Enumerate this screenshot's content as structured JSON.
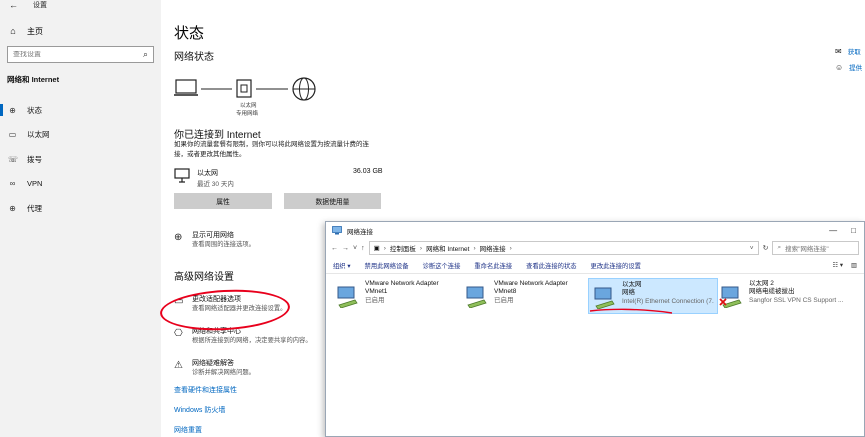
{
  "settings": {
    "back_glyph": "←",
    "window_title": "设置",
    "home_label": "主页",
    "search_placeholder": "查找设置",
    "section_label": "网络和 Internet",
    "nav": [
      {
        "label": "状态",
        "icon": "globe-icon",
        "active": true
      },
      {
        "label": "以太网",
        "icon": "monitor-icon",
        "active": false
      },
      {
        "label": "拨号",
        "icon": "phone-icon",
        "active": false
      },
      {
        "label": "VPN",
        "icon": "vpn-icon",
        "active": false
      },
      {
        "label": "代理",
        "icon": "globe-icon",
        "active": false
      }
    ]
  },
  "status": {
    "title": "状态",
    "subtitle": "网络状态",
    "diagram_label_1": "以太网",
    "diagram_label_2": "专用网络",
    "connected_title": "你已连接到 Internet",
    "connected_desc": "如果你的流量套餐有限制，则你可以将此网络设置为按流量计费的连接，或者更改其他属性。",
    "network_name": "以太网",
    "network_sub": "最近 30 天内",
    "network_usage": "36.03 GB",
    "btn_properties": "属性",
    "btn_data_usage": "数据使用量",
    "show_networks_title": "显示可用网络",
    "show_networks_sub": "查看周围的连接选项。",
    "advanced_title": "高级网络设置",
    "adapter_title": "更改适配器选项",
    "adapter_sub": "查看网络适配器并更改连接设置。",
    "sharing_title": "网络和共享中心",
    "sharing_sub": "根据所连接到的网络，决定要共享的内容。",
    "troubleshoot_title": "网络疑难解答",
    "troubleshoot_sub": "诊断并解决网络问题。",
    "link_hardware": "查看硬件和连接属性",
    "link_firewall": "Windows 防火墙",
    "link_reset": "网络重置",
    "right_help": "获取",
    "right_feedback": "提供"
  },
  "netconn": {
    "window_title": "网络连接",
    "window_controls": {
      "minimize": "—",
      "maximize": "□"
    },
    "breadcrumb": [
      "控制面板",
      "网络和 Internet",
      "网络连接"
    ],
    "search_placeholder": "搜索\"网络连接\"",
    "commands": [
      "组织 ▾",
      "禁用此网络设备",
      "诊断这个连接",
      "重命名此连接",
      "查看此连接的状态",
      "更改此连接的设置"
    ],
    "adapters": [
      {
        "line1": "VMware Network Adapter",
        "line2": "VMnet1",
        "line3": "已启用",
        "selected": false,
        "error": false
      },
      {
        "line1": "VMware Network Adapter",
        "line2": "VMnet8",
        "line3": "已启用",
        "selected": false,
        "error": false
      },
      {
        "line1": "以太网",
        "line2": "网络",
        "line3": "Intel(R) Ethernet Connection (7...",
        "selected": true,
        "error": false
      },
      {
        "line1": "以太网 2",
        "line2": "网络电缆被拔出",
        "line3": "Sangfor SSL VPN CS Support ...",
        "selected": false,
        "error": true
      }
    ]
  },
  "colors": {
    "accent": "#0067c0",
    "annotation_red": "#e8001c",
    "selection": "#cce8ff"
  }
}
